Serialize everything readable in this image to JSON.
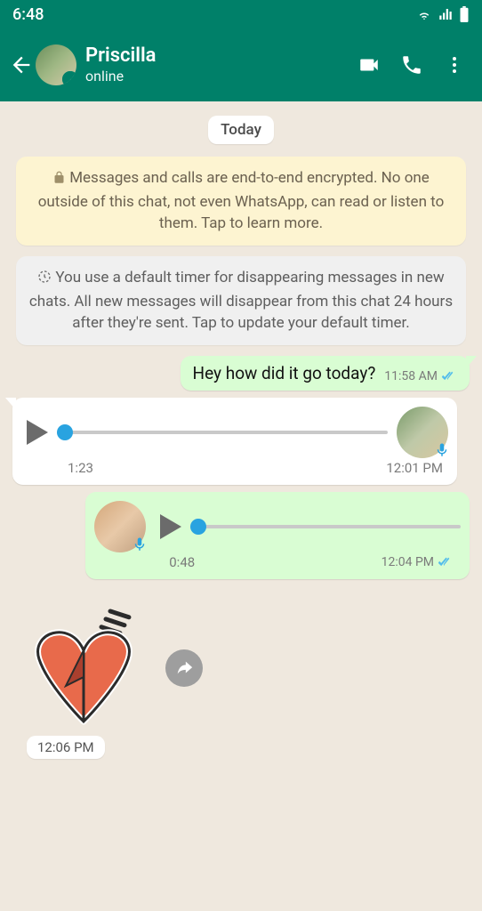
{
  "status_bar": {
    "time": "6:48"
  },
  "header": {
    "contact_name": "Priscilla",
    "status": "online"
  },
  "chat": {
    "date_label": "Today",
    "encryption_notice": "Messages and calls are end-to-end encrypted. No one outside of this chat, not even WhatsApp, can read or listen to them. Tap to learn more.",
    "timer_notice": "You use a default timer for disappearing messages in new chats. All new messages will disappear from this chat 24 hours after they're sent. Tap to update your default timer.",
    "messages": {
      "m1": {
        "text": "Hey how did it go today?",
        "time": "11:58 AM"
      },
      "m2": {
        "duration": "1:23",
        "time": "12:01 PM"
      },
      "m3": {
        "duration": "0:48",
        "time": "12:04 PM"
      },
      "m4": {
        "time": "12:06 PM"
      }
    }
  }
}
